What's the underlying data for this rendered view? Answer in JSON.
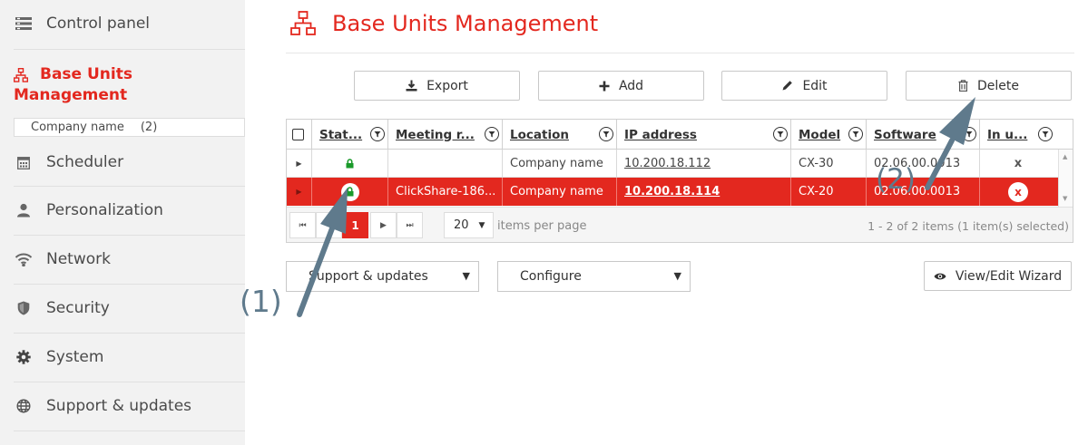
{
  "sidebar": {
    "items": [
      {
        "label": "Control panel",
        "icon": "control-panel-icon"
      },
      {
        "label": "Base Units Management",
        "icon": "network-tree-icon"
      },
      {
        "label": "Scheduler",
        "icon": "calendar-icon"
      },
      {
        "label": "Personalization",
        "icon": "user-icon"
      },
      {
        "label": "Network",
        "icon": "wifi-icon"
      },
      {
        "label": "Security",
        "icon": "shield-icon"
      },
      {
        "label": "System",
        "icon": "gear-icon"
      },
      {
        "label": "Support & updates",
        "icon": "globe-icon"
      }
    ],
    "active_line1": "Base Units",
    "active_line2": "Management",
    "subitem": {
      "label": "Company name",
      "count": "(2)"
    }
  },
  "page": {
    "title": "Base Units Management",
    "accent_color": "#e3281f"
  },
  "toolbar": {
    "export": "Export",
    "add": "Add",
    "edit": "Edit",
    "delete": "Delete"
  },
  "grid": {
    "columns": [
      "Stat...",
      "Meeting r...",
      "Location",
      "IP address",
      "Model",
      "Software",
      "In u..."
    ],
    "rows": [
      {
        "status": "locked",
        "meeting_room": "",
        "location": "Company name",
        "ip": "10.200.18.112",
        "model": "CX-30",
        "software": "02.06.00.0013",
        "in_use": "x",
        "selected": false
      },
      {
        "status": "locked",
        "meeting_room": "ClickShare-186...",
        "location": "Company name",
        "ip": "10.200.18.114",
        "model": "CX-20",
        "software": "02.06.00.0013",
        "in_use": "x",
        "selected": true
      }
    ],
    "pager": {
      "current_page": "1",
      "page_size": "20",
      "per_page_label": "items per page",
      "summary": "1 - 2 of 2 items (1 item(s) selected)"
    }
  },
  "bottom": {
    "support_dropdown": "Support & updates",
    "configure_dropdown": "Configure",
    "wizard_button": "View/Edit Wizard"
  },
  "annotations": {
    "label1": "(1)",
    "label2": "(2)",
    "arrow_color": "#5f7a8c"
  }
}
